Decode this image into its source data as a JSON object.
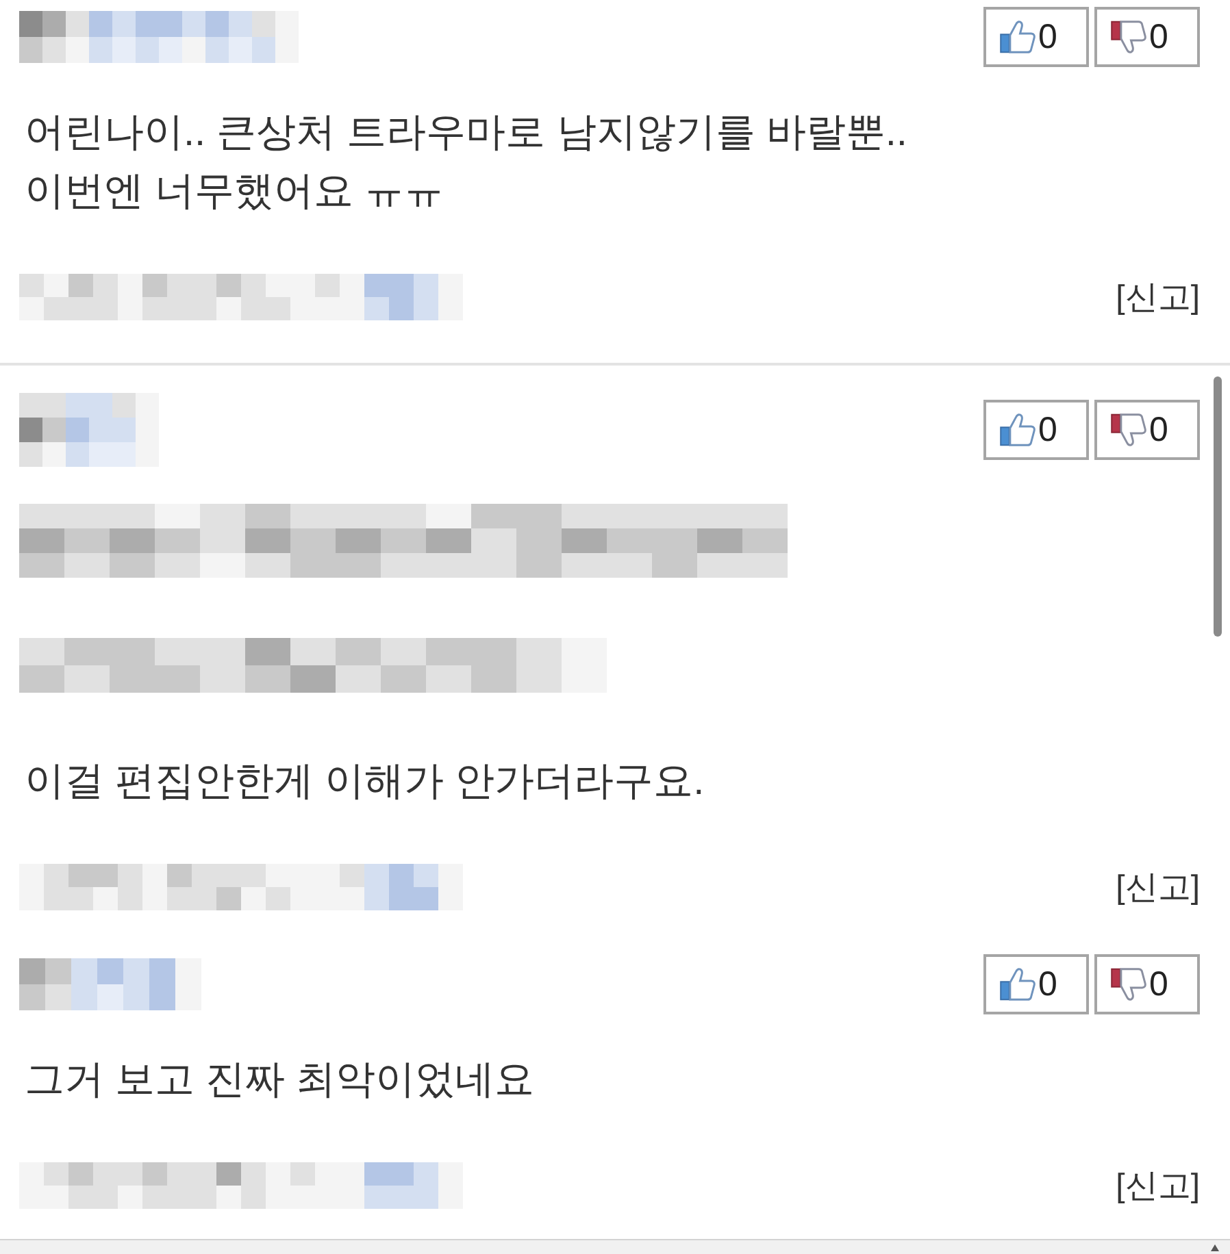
{
  "comments": [
    {
      "votes": [
        {
          "kind": "up",
          "count": "0"
        },
        {
          "kind": "down",
          "count": "0"
        }
      ],
      "body": [
        {
          "kind": "text",
          "text": "어린나이.. 큰상처 트라우마로 남지않기를 바랄뿐..\n이번엔 너무했어요 ㅠㅠ"
        }
      ],
      "report": "[신고]"
    }
  ],
  "scroll_panel": {
    "comments": [
      {
        "votes": [
          {
            "kind": "up",
            "count": "0"
          },
          {
            "kind": "down",
            "count": "0"
          }
        ],
        "body": [
          {
            "kind": "blurred"
          },
          {
            "kind": "blurred"
          },
          {
            "kind": "text",
            "text": "이걸 편집안한게 이해가 안가더라구요."
          }
        ],
        "report": "[신고]"
      },
      {
        "votes": [
          {
            "kind": "up",
            "count": "0"
          },
          {
            "kind": "down",
            "count": "0"
          }
        ],
        "body": [
          {
            "kind": "text",
            "text": "그거 보고 진짜 최악이었네요"
          }
        ],
        "report": "[신고]"
      }
    ]
  }
}
